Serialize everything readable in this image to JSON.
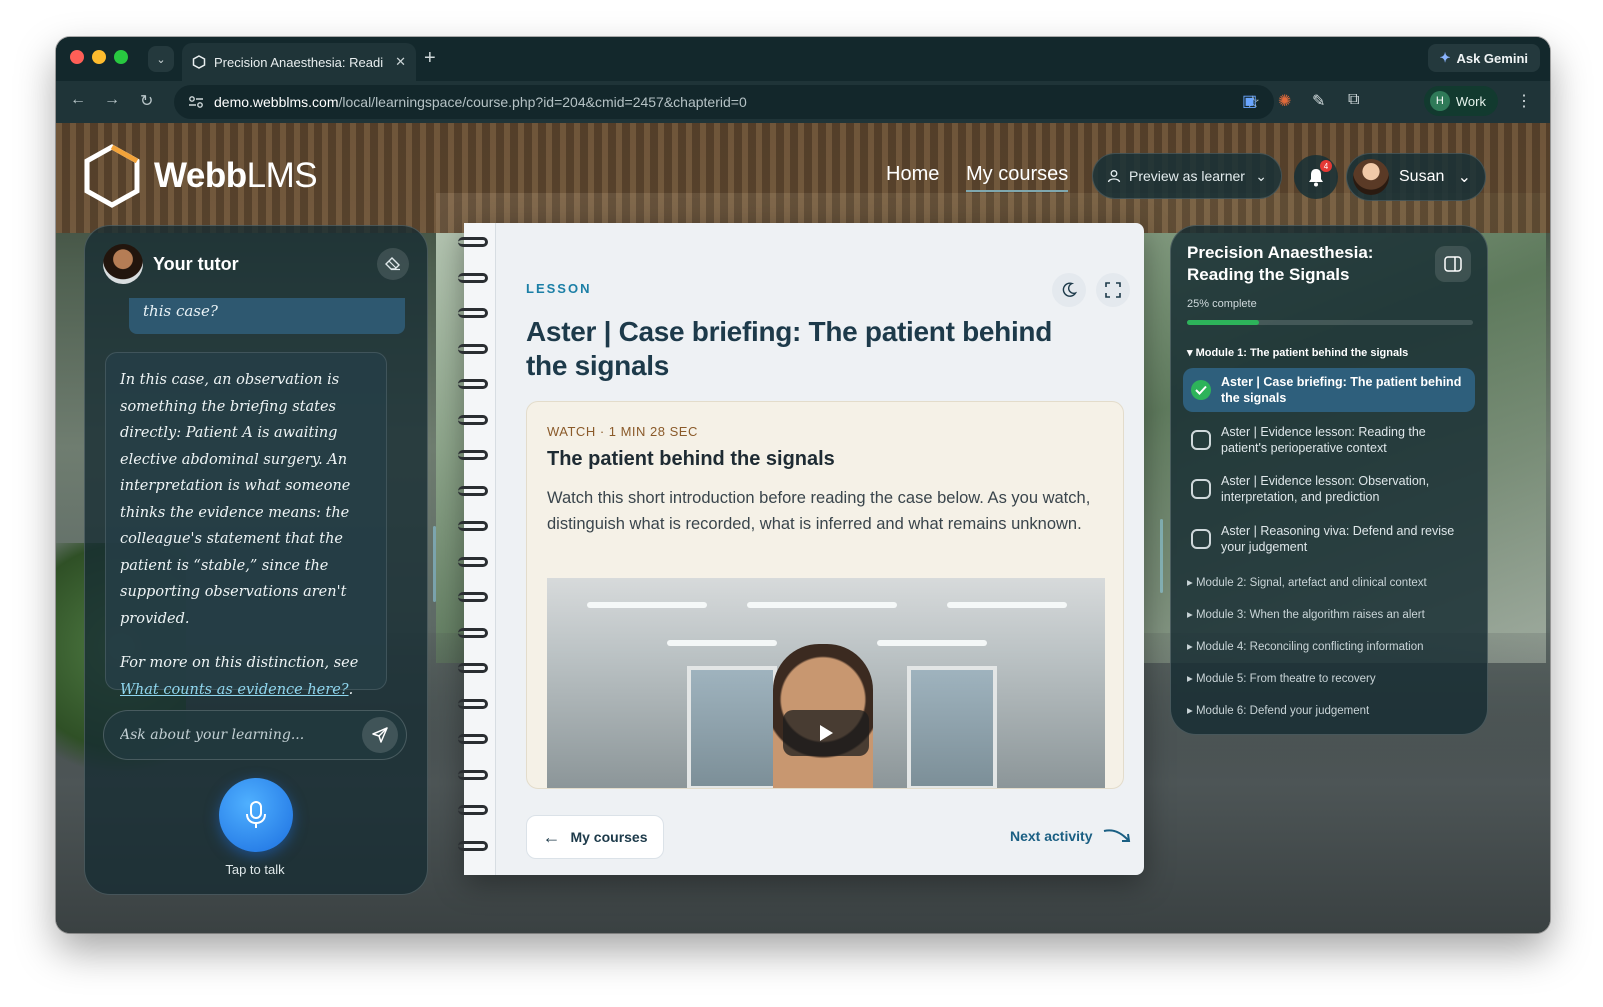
{
  "browser": {
    "tab_title": "Precision Anaesthesia: Readi",
    "new_tab": "+",
    "ask_gemini": "Ask Gemini",
    "url_host": "demo.webblms.com",
    "url_path": "/local/learningspace/course.php?id=204&cmid=2457&chapterid=0",
    "profile_initial": "H",
    "profile_label": "Work"
  },
  "header": {
    "brand_bold": "Webb",
    "brand_light": "LMS",
    "nav_home": "Home",
    "nav_my_courses": "My courses",
    "preview_label": "Preview as learner",
    "notification_count": "4",
    "user_name": "Susan"
  },
  "tutor": {
    "title": "Your tutor",
    "question_excerpt": "this case?",
    "answer": "In this case, an observation is something the briefing states directly: Patient A is awaiting elective abdominal surgery. An interpretation is what someone thinks the evidence means: the colleague's statement that the patient is “stable,” since the supporting observations aren't provided.",
    "ref_prefix": "For more on this distinction, see ",
    "ref_link": "What counts as evidence here?",
    "ref_suffix": ".",
    "input_placeholder": "Ask about your learning...",
    "mic_label": "Tap to talk"
  },
  "lesson": {
    "tag": "LESSON",
    "title": "Aster | Case briefing: The patient behind the signals",
    "card_meta": "WATCH · 1 MIN 28 SEC",
    "card_title": "The patient behind the signals",
    "card_desc": "Watch this short introduction before reading the case below. As you watch, distinguish what is recorded, what is inferred and what remains unknown.",
    "back_button": "My courses",
    "next_button": "Next activity"
  },
  "course": {
    "title": "Precision Anaesthesia: Reading the Signals",
    "progress_text": "25% complete",
    "progress_fraction": 0.25,
    "module1": "▾ Module 1: The patient behind the signals",
    "activities": [
      {
        "label": "Aster | Case briefing: The patient behind the signals",
        "done": true
      },
      {
        "label": "Aster | Evidence lesson: Reading the patient's perioperative context",
        "done": false
      },
      {
        "label": "Aster | Evidence lesson: Observation, interpretation, and prediction",
        "done": false
      },
      {
        "label": "Aster | Reasoning viva: Defend and revise your judgement",
        "done": false
      }
    ],
    "modules": [
      "▸ Module 2: Signal, artefact and clinical context",
      "▸ Module 3: When the algorithm raises an alert",
      "▸ Module 4: Reconciling conflicting information",
      "▸ Module 5: From theatre to recovery",
      "▸ Module 6: Defend your judgement"
    ]
  },
  "colors": {
    "accent": "#1b7fa6",
    "progress": "#2db35a",
    "panel": "#162c32"
  }
}
